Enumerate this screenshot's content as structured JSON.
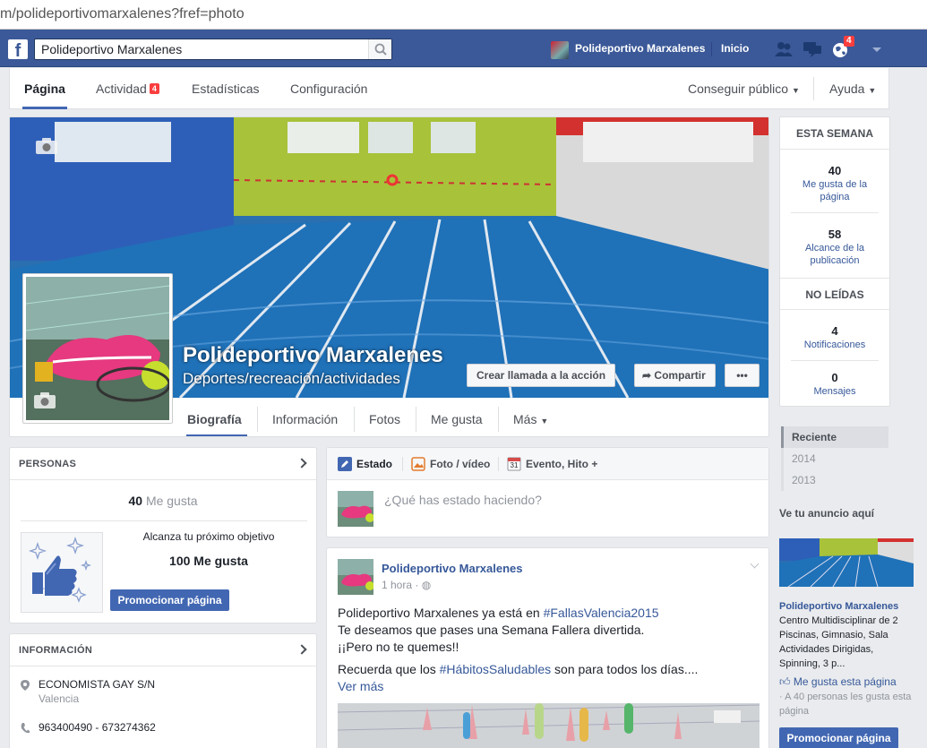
{
  "browser": {
    "url": "m/polideportivomarxalenes?fref=photo"
  },
  "bluebar": {
    "search_value": "Polideportivo Marxalenes",
    "user_name": "Polideportivo Marxalenes",
    "home_label": "Inicio",
    "notif_count": "4"
  },
  "pagenav": {
    "pagina": "Página",
    "actividad": "Actividad",
    "actividad_badge": "4",
    "estadisticas": "Estadísticas",
    "configuracion": "Configuración",
    "conseguir_publico": "Conseguir público",
    "ayuda": "Ayuda"
  },
  "cover": {
    "title": "Polideportivo Marxalenes",
    "subtitle": "Deportes/recreación/actividades",
    "cta_label": "Crear llamada a la acción",
    "share_label": "Compartir",
    "more_label": "•••"
  },
  "tabs": {
    "biografia": "Biografía",
    "informacion": "Información",
    "fotos": "Fotos",
    "me_gusta": "Me gusta",
    "mas": "Más"
  },
  "this_week": {
    "heading": "ESTA SEMANA",
    "likes_num": "40",
    "likes_label": "Me gusta de la página",
    "reach_num": "58",
    "reach_label": "Alcance de la publicación",
    "unread_heading": "NO LEÍDAS",
    "notif_num": "4",
    "notif_label": "Notificaciones",
    "msg_num": "0",
    "msg_label": "Mensajes"
  },
  "timeline": {
    "items": [
      "Reciente",
      "2014",
      "2013"
    ]
  },
  "ad": {
    "title": "Ve tu anuncio aquí",
    "name": "Polideportivo Marxalenes",
    "desc": "Centro Multidisciplinar de 2 Piscinas, Gimnasio, Sala Actividades Dirigidas, Spinning, 3 p...",
    "like_label": "Me gusta esta página",
    "sub": "· A 40 personas les gusta esta página",
    "button": "Promocionar página"
  },
  "personas": {
    "heading": "PERSONAS",
    "likes_num": "40",
    "likes_label": "Me gusta",
    "goal_text": "Alcanza tu próximo objetivo",
    "goal_value": "100 Me gusta",
    "button": "Promocionar página"
  },
  "informacion": {
    "heading": "INFORMACIÓN",
    "address": "ECONOMISTA GAY S/N",
    "city": "Valencia",
    "phone": "963400490 - 673274362"
  },
  "composer": {
    "estado": "Estado",
    "foto": "Foto / vídeo",
    "evento": "Evento, Hito +",
    "calendar_day": "31",
    "placeholder": "¿Qué has estado haciendo?"
  },
  "post": {
    "author": "Polideportivo Marxalenes",
    "time": "1 hora ·",
    "line1_pre": "Polideportivo Marxalenes ya está en ",
    "line1_tag": "#FallasValencia2015",
    "line2": "Te deseamos que pases una Semana Fallera divertida.",
    "line3": "¡¡Pero no te quemes!!",
    "line4_pre": "Recuerda que los ",
    "line4_tag": "#HábitosSaludables",
    "line4_post": " son para todos los días....",
    "ver_mas": "Ver más"
  },
  "colors": {
    "brand_blue": "#3b5998",
    "button_blue": "#4267b2",
    "link_blue": "#365899",
    "badge_red": "#fa3e3e"
  }
}
